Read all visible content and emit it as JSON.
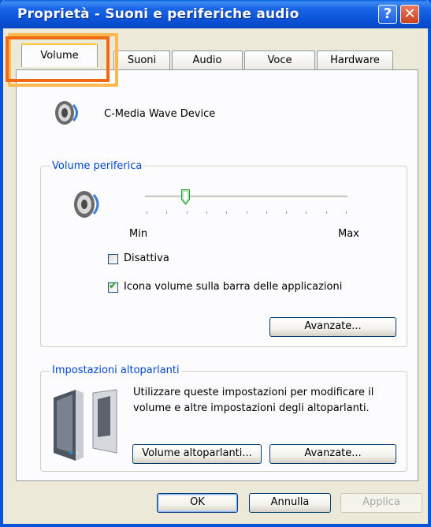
{
  "window": {
    "title": "Proprietà - Suoni e periferiche audio",
    "help_glyph": "?",
    "close_glyph": "✕"
  },
  "tabs": [
    {
      "label": "Volume",
      "active": true
    },
    {
      "label": "Suoni",
      "active": false
    },
    {
      "label": "Audio",
      "active": false
    },
    {
      "label": "Voce",
      "active": false
    },
    {
      "label": "Hardware",
      "active": false
    }
  ],
  "device": {
    "name": "C-Media Wave Device",
    "icon": "speaker-icon"
  },
  "device_volume": {
    "group_label": "Volume periferica",
    "slider_min_label": "Min",
    "slider_max_label": "Max",
    "slider_value_fraction": 0.2,
    "mute_label": "Disattiva",
    "mute_checked": false,
    "tray_icon_label": "Icona volume sulla barra delle applicazioni",
    "tray_icon_checked": true,
    "advanced_button": "Avanzate..."
  },
  "speaker_settings": {
    "group_label": "Impostazioni altoparlanti",
    "description": "Utilizzare queste impostazioni per modificare il volume e altre impostazioni degli altoparlanti.",
    "speaker_volume_button": "Volume altoparlanti...",
    "advanced_button": "Avanzate...",
    "icon": "speakers-icon"
  },
  "footer": {
    "ok": "OK",
    "cancel": "Annulla",
    "apply": "Applica"
  },
  "colors": {
    "title_bar": "#0a53d8",
    "group_label": "#0046d5",
    "highlight_outer": "#ffb84d",
    "highlight_inner": "#ef6a12"
  }
}
